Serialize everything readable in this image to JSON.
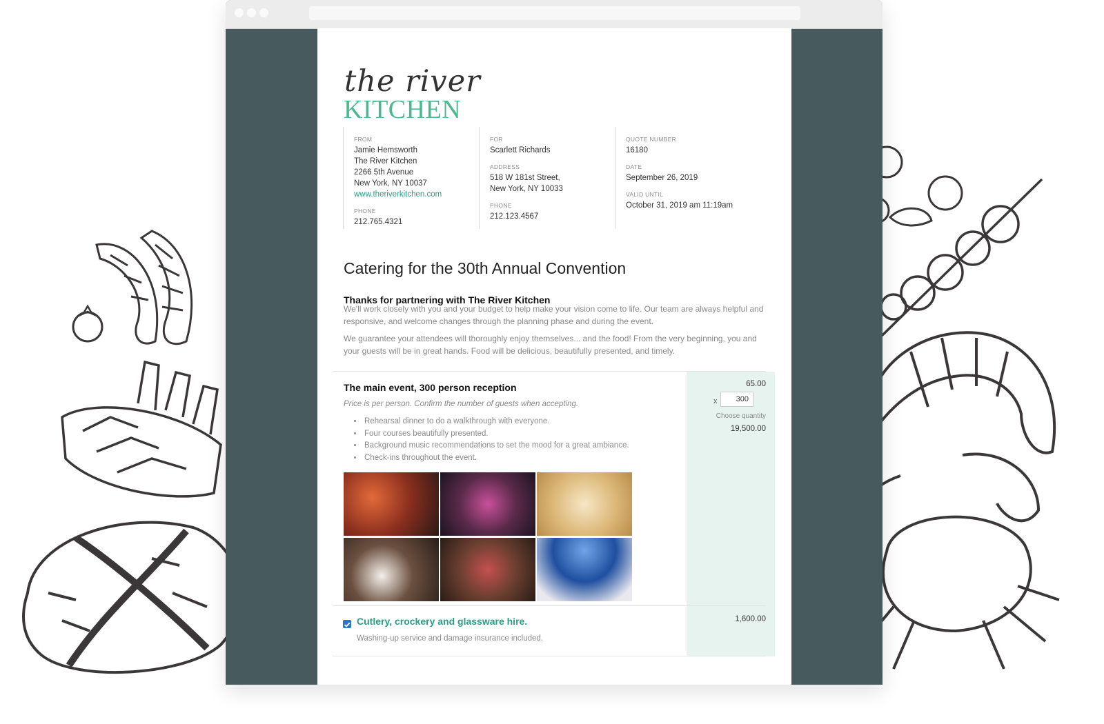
{
  "brand": {
    "logo_line1": "the river",
    "logo_line2": "KITCHEN",
    "accent": "#4bb890",
    "dark": "#475b5f"
  },
  "from": {
    "label": "FROM",
    "name": "Jamie Hemsworth",
    "company": "The River Kitchen",
    "street": "2266 5th Avenue",
    "city": "New York, NY 10037",
    "website": "www.theriverkitchen.com",
    "phone_label": "PHONE",
    "phone": "212.765.4321"
  },
  "for": {
    "label": "FOR",
    "name": "Scarlett Richards",
    "address_label": "ADDRESS",
    "street": "518 W 181st Street,",
    "city": "New York, NY 10033",
    "phone_label": "PHONE",
    "phone": "212.123.4567"
  },
  "quote": {
    "number_label": "QUOTE NUMBER",
    "number": "16180",
    "date_label": "DATE",
    "date": "September 26, 2019",
    "valid_label": "VALID UNTIL",
    "valid": "October 31, 2019 am 11:19am"
  },
  "title": "Catering for the 30th Annual Convention",
  "intro": {
    "heading": "Thanks for partnering with The River Kitchen",
    "p1": "We'll work closely with you and your budget to help make your vision come to life. Our team are always helpful and responsive, and welcome changes through the planning phase and during the event.",
    "p2": "We guarantee your attendees will thoroughly enjoy themselves... and the food! From the very beginning, you and your guests will be in great hands. Food will be delicious, beautifully presented, and timely."
  },
  "main_item": {
    "title": "The main event, 300 person reception",
    "note": "Price is per person. Confirm the number of guests when accepting.",
    "bullets": [
      "Rehearsal dinner to do a walkthrough with everyone.",
      "Four courses beautifully presented.",
      "Background music recommendations to set the mood for a great ambiance.",
      "Check-ins throughout the event."
    ],
    "unit_price": "65.00",
    "qty_prefix": "x",
    "quantity": "300",
    "qty_note": "Choose quantity",
    "total": "19,500.00"
  },
  "option_item": {
    "title": "Cutlery, crockery and glassware hire.",
    "note": "Washing-up service and damage insurance included.",
    "price": "1,600.00",
    "checked": true
  }
}
